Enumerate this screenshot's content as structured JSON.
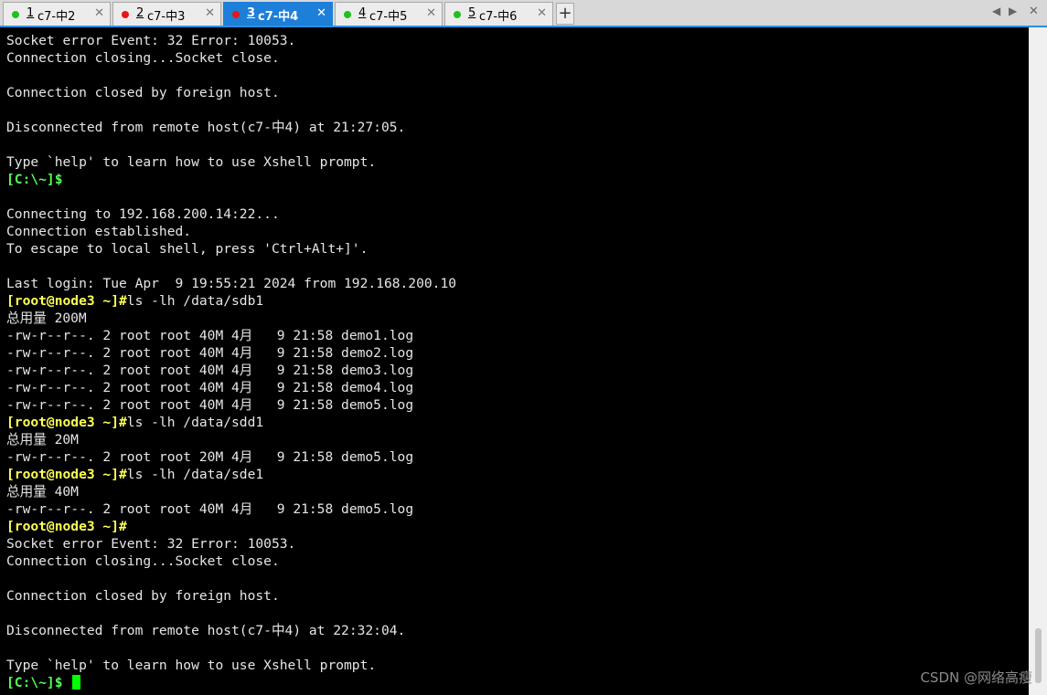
{
  "tabs": [
    {
      "num": "1",
      "title": " c7-中2",
      "status_color": "#1ec21e",
      "active": false
    },
    {
      "num": "2",
      "title": " c7-中3",
      "status_color": "#e81515",
      "active": false
    },
    {
      "num": "3",
      "title": " c7-中4",
      "status_color": "#e81515",
      "active": true
    },
    {
      "num": "4",
      "title": " c7-中5",
      "status_color": "#1ec21e",
      "active": false
    },
    {
      "num": "5",
      "title": " c7-中6",
      "status_color": "#1ec21e",
      "active": false
    }
  ],
  "tab_close_glyph": "✕",
  "add_tab_glyph": "+",
  "nav": {
    "left": "◀",
    "right": "▶"
  },
  "terminal": {
    "lines": [
      {
        "text": "Socket error Event: 32 Error: 10053."
      },
      {
        "text": "Connection closing...Socket close."
      },
      {
        "text": ""
      },
      {
        "text": "Connection closed by foreign host."
      },
      {
        "text": ""
      },
      {
        "text": "Disconnected from remote host(c7-中4) at 21:27:05."
      },
      {
        "text": ""
      },
      {
        "text": "Type `help' to learn how to use Xshell prompt."
      },
      {
        "prompt": "[C:\\~]$",
        "text": "",
        "prompt_color": "green"
      },
      {
        "text": ""
      },
      {
        "text": "Connecting to 192.168.200.14:22..."
      },
      {
        "text": "Connection established."
      },
      {
        "text": "To escape to local shell, press 'Ctrl+Alt+]'."
      },
      {
        "text": ""
      },
      {
        "text": "Last login: Tue Apr  9 19:55:21 2024 from 192.168.200.10"
      },
      {
        "prompt": "[root@node3 ~]#",
        "text": "ls -lh /data/sdb1",
        "prompt_color": "yellow"
      },
      {
        "text": "总用量 200M"
      },
      {
        "text": "-rw-r--r--. 2 root root 40M 4月   9 21:58 demo1.log"
      },
      {
        "text": "-rw-r--r--. 2 root root 40M 4月   9 21:58 demo2.log"
      },
      {
        "text": "-rw-r--r--. 2 root root 40M 4月   9 21:58 demo3.log"
      },
      {
        "text": "-rw-r--r--. 2 root root 40M 4月   9 21:58 demo4.log"
      },
      {
        "text": "-rw-r--r--. 2 root root 40M 4月   9 21:58 demo5.log"
      },
      {
        "prompt": "[root@node3 ~]#",
        "text": "ls -lh /data/sdd1",
        "prompt_color": "yellow"
      },
      {
        "text": "总用量 20M"
      },
      {
        "text": "-rw-r--r--. 2 root root 20M 4月   9 21:58 demo5.log"
      },
      {
        "prompt": "[root@node3 ~]#",
        "text": "ls -lh /data/sde1",
        "prompt_color": "yellow"
      },
      {
        "text": "总用量 40M"
      },
      {
        "text": "-rw-r--r--. 2 root root 40M 4月   9 21:58 demo5.log"
      },
      {
        "prompt": "[root@node3 ~]#",
        "text": "",
        "prompt_color": "yellow"
      },
      {
        "text": "Socket error Event: 32 Error: 10053."
      },
      {
        "text": "Connection closing...Socket close."
      },
      {
        "text": ""
      },
      {
        "text": "Connection closed by foreign host."
      },
      {
        "text": ""
      },
      {
        "text": "Disconnected from remote host(c7-中4) at 22:32:04."
      },
      {
        "text": ""
      },
      {
        "text": "Type `help' to learn how to use Xshell prompt."
      },
      {
        "prompt": "[C:\\~]$",
        "text": " ",
        "prompt_color": "green",
        "cursor": true
      }
    ]
  },
  "watermark": "CSDN @网络高瘦",
  "colors": {
    "accent": "#1e7fd8",
    "prompt_yellow": "#ffff54",
    "prompt_green": "#54ff54",
    "cursor": "#00ff00"
  }
}
